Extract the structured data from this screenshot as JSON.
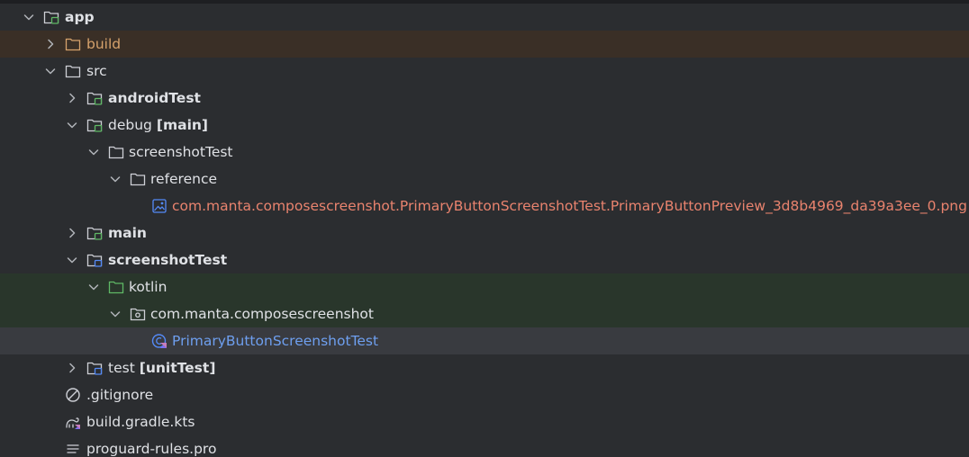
{
  "tree": {
    "rows": [
      {
        "label": "app",
        "bold": true
      },
      {
        "label": "build"
      },
      {
        "label": "src"
      },
      {
        "label": "androidTest",
        "bold": true
      },
      {
        "label": "debug",
        "suffix": "[main]"
      },
      {
        "label": "screenshotTest"
      },
      {
        "label": "reference"
      },
      {
        "label": "com.manta.composescreenshot.PrimaryButtonScreenshotTest.PrimaryButtonPreview_3d8b4969_da39a3ee_0.png"
      },
      {
        "label": "main",
        "bold": true
      },
      {
        "label": "screenshotTest",
        "bold": true
      },
      {
        "label": "kotlin"
      },
      {
        "label": "com.manta.composescreenshot"
      },
      {
        "label": "PrimaryButtonScreenshotTest"
      },
      {
        "label": "test",
        "suffix": "[unitTest]"
      },
      {
        "label": ".gitignore"
      },
      {
        "label": "build.gradle.kts"
      },
      {
        "label": "proguard-rules.pro"
      }
    ]
  },
  "colors": {
    "background": "#2b2d30",
    "excluded_text": "#d6a26c",
    "modified_file_text": "#e9836e",
    "selected_class_text": "#6e9fef",
    "build_row_highlight": "#3a2f26",
    "test_source_highlight": "#29362b",
    "selection_highlight": "#393b40"
  },
  "icons": {
    "expanded": "chevron-down-icon",
    "collapsed": "chevron-right-icon",
    "module": "module-folder-icon",
    "folder": "folder-icon",
    "source_root": "source-root-folder-icon",
    "test_root": "test-root-folder-icon",
    "package": "package-icon",
    "image": "image-file-icon",
    "kotlin_test_class": "kotlin-test-class-icon",
    "ignore": "ignore-file-icon",
    "gradle": "gradle-file-icon",
    "text": "text-file-icon"
  }
}
